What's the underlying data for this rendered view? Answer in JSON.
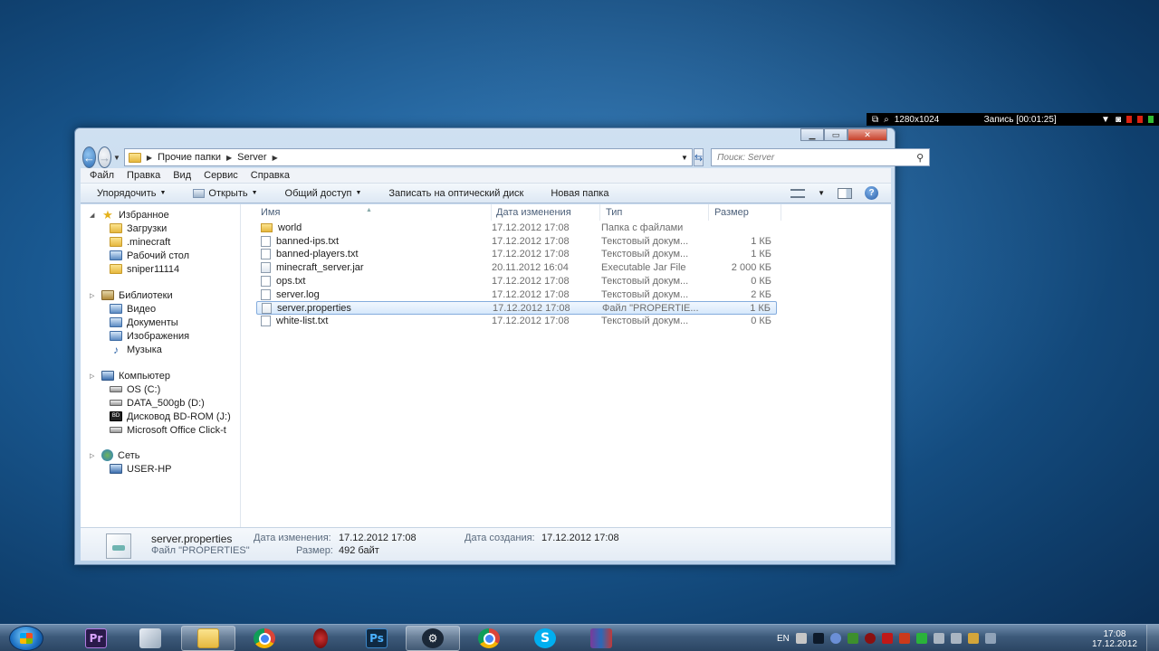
{
  "recorder": {
    "resolution": "1280x1024",
    "record_label": "Запись [00:01:25]"
  },
  "window": {
    "address": {
      "crumbs": [
        "Прочие папки",
        "Server"
      ]
    },
    "search_placeholder": "Поиск: Server",
    "menu": [
      "Файл",
      "Правка",
      "Вид",
      "Сервис",
      "Справка"
    ],
    "toolbar": {
      "organize": "Упорядочить",
      "open": "Открыть",
      "share": "Общий доступ",
      "burn": "Записать на оптический диск",
      "new_folder": "Новая папка"
    },
    "nav": {
      "favorites": "Избранное",
      "favorites_items": [
        "Загрузки",
        ".minecraft",
        "Рабочий стол",
        "sniper11114"
      ],
      "libraries": "Библиотеки",
      "libraries_items": [
        "Видео",
        "Документы",
        "Изображения",
        "Музыка"
      ],
      "computer": "Компьютер",
      "computer_items": [
        "OS (C:)",
        "DATA_500gb (D:)",
        "Дисковод BD-ROM (J:)",
        "Microsoft Office Click-t"
      ],
      "network": "Сеть",
      "network_items": [
        "USER-HP"
      ]
    },
    "columns": {
      "name": "Имя",
      "date": "Дата изменения",
      "type": "Тип",
      "size": "Размер"
    },
    "files": [
      {
        "name": "world",
        "date": "17.12.2012 17:08",
        "type": "Папка с файлами",
        "size": "",
        "icon": "folder-icon"
      },
      {
        "name": "banned-ips.txt",
        "date": "17.12.2012 17:08",
        "type": "Текстовый докум...",
        "size": "1 КБ",
        "icon": "text-file-icon"
      },
      {
        "name": "banned-players.txt",
        "date": "17.12.2012 17:08",
        "type": "Текстовый докум...",
        "size": "1 КБ",
        "icon": "text-file-icon"
      },
      {
        "name": "minecraft_server.jar",
        "date": "20.11.2012 16:04",
        "type": "Executable Jar File",
        "size": "2 000 КБ",
        "icon": "jar-file-icon"
      },
      {
        "name": "ops.txt",
        "date": "17.12.2012 17:08",
        "type": "Текстовый докум...",
        "size": "0 КБ",
        "icon": "text-file-icon"
      },
      {
        "name": "server.log",
        "date": "17.12.2012 17:08",
        "type": "Текстовый докум...",
        "size": "2 КБ",
        "icon": "text-file-icon"
      },
      {
        "name": "server.properties",
        "date": "17.12.2012 17:08",
        "type": "Файл \"PROPERTIE...",
        "size": "1 КБ",
        "icon": "properties-file-icon",
        "selected": true
      },
      {
        "name": "white-list.txt",
        "date": "17.12.2012 17:08",
        "type": "Текстовый докум...",
        "size": "0 КБ",
        "icon": "text-file-icon"
      }
    ],
    "details": {
      "filename": "server.properties",
      "filetype": "Файл \"PROPERTIES\"",
      "modified_label": "Дата изменения:",
      "modified_value": "17.12.2012 17:08",
      "size_label": "Размер:",
      "size_value": "492 байт",
      "created_label": "Дата создания:",
      "created_value": "17.12.2012 17:08"
    }
  },
  "taskbar": {
    "apps": [
      "Adobe Premiere",
      "Pen tool",
      "Windows Explorer",
      "Google Chrome",
      "Recorder",
      "Photoshop",
      "Steam",
      "Google Chrome",
      "Skype",
      "WinRAR"
    ],
    "lang": "EN",
    "time": "17:08",
    "date": "17.12.2012"
  }
}
